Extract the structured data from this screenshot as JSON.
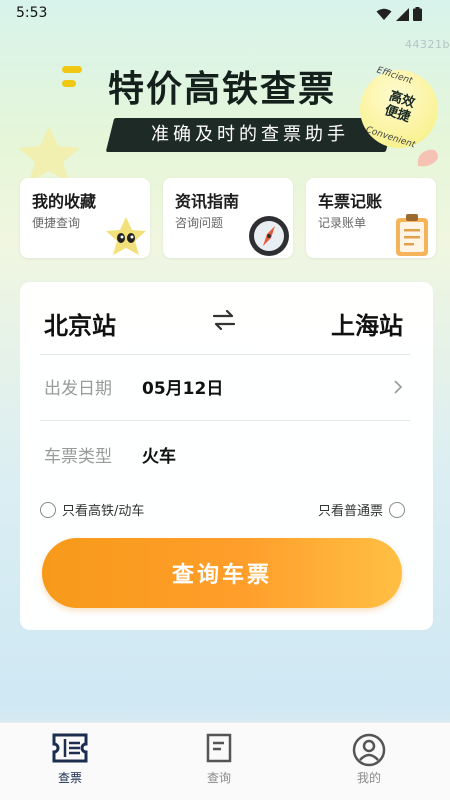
{
  "status_bar": {
    "time": "5:53"
  },
  "app_id": "44321b",
  "hero": {
    "title": "特价高铁查票",
    "subtitle": "准确及时的查票助手",
    "badge": {
      "en_top": "Efficient",
      "cn": "高效便捷",
      "en_bottom": "Convenient"
    }
  },
  "cards": [
    {
      "title": "我的收藏",
      "subtitle": "便捷查询",
      "icon": "star-mascot-icon"
    },
    {
      "title": "资讯指南",
      "subtitle": "咨询问题",
      "icon": "compass-icon"
    },
    {
      "title": "车票记账",
      "subtitle": "记录账单",
      "icon": "clipboard-icon"
    }
  ],
  "query": {
    "from_station": "北京站",
    "to_station": "上海站",
    "date_label": "出发日期",
    "date_value": "05月12日",
    "type_label": "车票类型",
    "type_value": "火车",
    "option_highspeed": "只看高铁/动车",
    "option_normal": "只看普通票",
    "button_label": "查询车票"
  },
  "bottom_nav": [
    {
      "label": "查票",
      "active": true,
      "icon": "ticket-icon"
    },
    {
      "label": "查询",
      "active": false,
      "icon": "document-icon"
    },
    {
      "label": "我的",
      "active": false,
      "icon": "user-icon"
    }
  ],
  "colors": {
    "accent_orange": "#ff9e2a",
    "active_nav": "#1c2d4f",
    "inactive_nav": "#8a8a8a"
  }
}
